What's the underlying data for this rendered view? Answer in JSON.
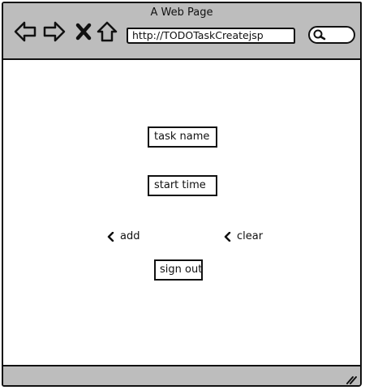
{
  "window": {
    "title": "A Web Page"
  },
  "toolbar": {
    "icons": [
      "back-arrow-icon",
      "forward-arrow-icon",
      "close-x-icon",
      "home-icon",
      "search-icon"
    ],
    "address_url": "http://TODOTaskCreatejsp"
  },
  "form": {
    "task_name_label": "task name",
    "start_time_label": "start time",
    "add_label": "add",
    "clear_label": "clear",
    "sign_out_label": "sign out"
  },
  "colors": {
    "chrome_gray": "#bdbdbd",
    "ink": "#111111",
    "background": "#ffffff"
  }
}
